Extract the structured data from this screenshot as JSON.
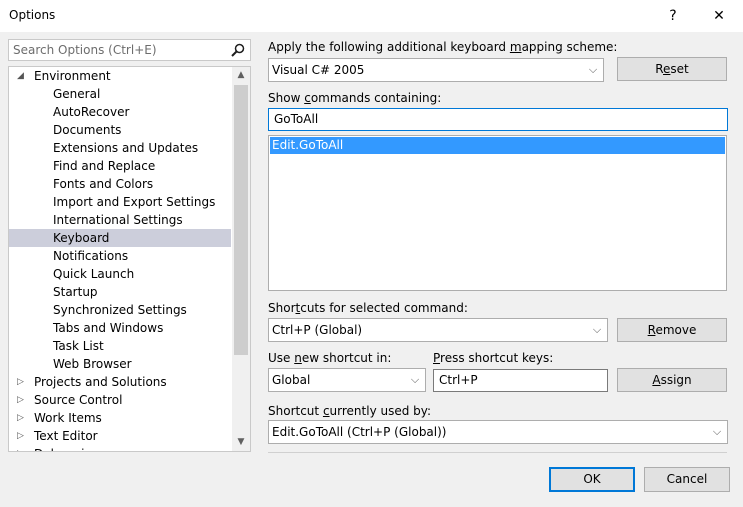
{
  "window": {
    "title": "Options",
    "help_glyph": "?",
    "close_glyph": "✕"
  },
  "search": {
    "placeholder": "Search Options (Ctrl+E)"
  },
  "tree": {
    "items": [
      {
        "label": "Environment",
        "level": 0,
        "expanded": true
      },
      {
        "label": "General",
        "level": 1
      },
      {
        "label": "AutoRecover",
        "level": 1
      },
      {
        "label": "Documents",
        "level": 1
      },
      {
        "label": "Extensions and Updates",
        "level": 1
      },
      {
        "label": "Find and Replace",
        "level": 1
      },
      {
        "label": "Fonts and Colors",
        "level": 1
      },
      {
        "label": "Import and Export Settings",
        "level": 1
      },
      {
        "label": "International Settings",
        "level": 1
      },
      {
        "label": "Keyboard",
        "level": 1,
        "selected": true
      },
      {
        "label": "Notifications",
        "level": 1
      },
      {
        "label": "Quick Launch",
        "level": 1
      },
      {
        "label": "Startup",
        "level": 1
      },
      {
        "label": "Synchronized Settings",
        "level": 1
      },
      {
        "label": "Tabs and Windows",
        "level": 1
      },
      {
        "label": "Task List",
        "level": 1
      },
      {
        "label": "Web Browser",
        "level": 1
      },
      {
        "label": "Projects and Solutions",
        "level": 0,
        "expanded": false
      },
      {
        "label": "Source Control",
        "level": 0,
        "expanded": false
      },
      {
        "label": "Work Items",
        "level": 0,
        "expanded": false
      },
      {
        "label": "Text Editor",
        "level": 0,
        "expanded": false
      },
      {
        "label": "Debugging",
        "level": 0,
        "expanded": false
      }
    ]
  },
  "mapping": {
    "label_pre": "Apply the following additional keyboard ",
    "label_u": "m",
    "label_post": "apping scheme:",
    "scheme": "Visual C# 2005",
    "reset_pre": "R",
    "reset_u": "e",
    "reset_post": "set"
  },
  "commands": {
    "label_pre": "Show ",
    "label_u": "c",
    "label_post": "ommands containing:",
    "filter": "GoToAll",
    "selected_item": "Edit.GoToAll"
  },
  "shortcuts": {
    "label_pre": "Shor",
    "label_u": "t",
    "label_post": "cuts for selected command:",
    "value": "Ctrl+P (Global)",
    "remove_pre": "",
    "remove_u": "R",
    "remove_post": "emove"
  },
  "new_shortcut": {
    "scope_label_pre": "Use ",
    "scope_label_u": "n",
    "scope_label_post": "ew shortcut in:",
    "scope_value": "Global",
    "keys_label_pre": "",
    "keys_label_u": "P",
    "keys_label_post": "ress shortcut keys:",
    "keys_value": "Ctrl+P",
    "assign_pre": "",
    "assign_u": "A",
    "assign_post": "ssign"
  },
  "used_by": {
    "label_pre": "Shortcut ",
    "label_u": "c",
    "label_post": "urrently used by:",
    "value": "Edit.GoToAll (Ctrl+P (Global))"
  },
  "footer": {
    "ok": "OK",
    "cancel": "Cancel"
  },
  "colors": {
    "accent": "#0078d7",
    "selection": "#3399ff",
    "tree_selection": "#cccedb"
  }
}
